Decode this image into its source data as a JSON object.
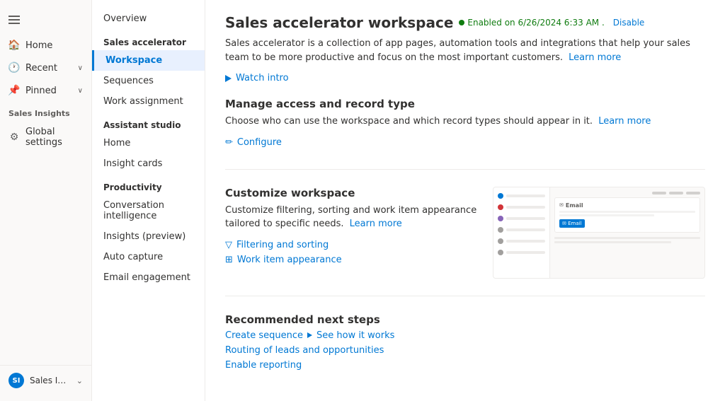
{
  "leftNav": {
    "hamburger": "☰",
    "items": [
      {
        "id": "home",
        "label": "Home",
        "icon": "🏠"
      },
      {
        "id": "recent",
        "label": "Recent",
        "icon": "🕐",
        "hasChevron": true
      },
      {
        "id": "pinned",
        "label": "Pinned",
        "icon": "📌",
        "hasChevron": true
      }
    ],
    "salesInsightsSection": "Sales Insights",
    "globalSettings": {
      "label": "Global settings",
      "icon": "⚙"
    },
    "bottomItem": {
      "initials": "SI",
      "label": "Sales Insights sett...",
      "chevron": "⌄"
    }
  },
  "sidebar": {
    "overview": "Overview",
    "salesAcceleratorSection": "Sales accelerator",
    "salesAcceleratorItems": [
      {
        "id": "workspace",
        "label": "Workspace",
        "active": true
      },
      {
        "id": "sequences",
        "label": "Sequences"
      },
      {
        "id": "work-assignment",
        "label": "Work assignment"
      }
    ],
    "assistantStudioSection": "Assistant studio",
    "assistantStudioItems": [
      {
        "id": "home",
        "label": "Home"
      },
      {
        "id": "insight-cards",
        "label": "Insight cards"
      }
    ],
    "productivitySection": "Productivity",
    "productivityItems": [
      {
        "id": "conversation-intelligence",
        "label": "Conversation intelligence"
      },
      {
        "id": "insights-preview",
        "label": "Insights (preview)"
      },
      {
        "id": "auto-capture",
        "label": "Auto capture"
      },
      {
        "id": "email-engagement",
        "label": "Email engagement"
      }
    ]
  },
  "main": {
    "title": "Sales accelerator workspace",
    "status": "Enabled on 6/26/2024 6:33 AM .",
    "disableLabel": "Disable",
    "description": "Sales accelerator is a collection of app pages, automation tools and integrations that help your sales team to be more productive and focus on the most important customers.",
    "learnMoreDesc": "Learn more",
    "watchIntro": "Watch intro",
    "manageAccess": {
      "title": "Manage access and record type",
      "description": "Choose who can use the workspace and which record types should appear in it.",
      "learnMore": "Learn more",
      "configureLabel": "Configure"
    },
    "customizeWorkspace": {
      "title": "Customize workspace",
      "description": "Customize filtering, sorting and work item appearance tailored to specific needs.",
      "learnMore": "Learn more",
      "filteringLabel": "Filtering and sorting",
      "workItemLabel": "Work item appearance",
      "preview": {
        "emailLabel": "Email"
      }
    },
    "recommendedNextSteps": {
      "title": "Recommended next steps",
      "createSequence": "Create sequence",
      "seeHowItWorks": "See how it works",
      "routingLabel": "Routing of leads and opportunities",
      "enableReporting": "Enable reporting"
    }
  }
}
